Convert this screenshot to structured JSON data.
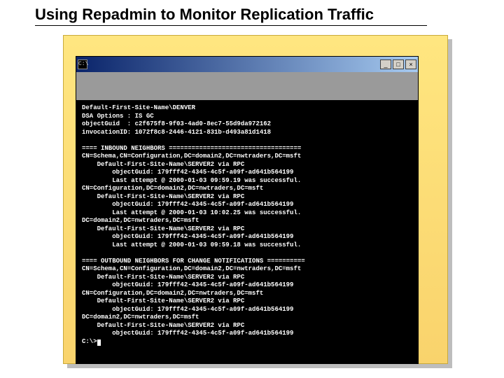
{
  "heading": "Using Repadmin to Monitor Replication Traffic",
  "cmd": {
    "icon_text": "C:\\",
    "btn_min": "_",
    "btn_max": "□",
    "btn_close": "×",
    "prompt": "C:\\>",
    "header": [
      "Default-First-Site-Name\\DENVER",
      "DSA Options : IS GC",
      "objectGuid  : c2f675f8-9f03-4ad0-8ec7-55d9da972162",
      "invocationID: 1072f8c8-2446-4121-831b-d493a81d1418"
    ],
    "inbound_heading": "==== INBOUND NEIGHBORS ===================================",
    "inbound": [
      "CN=Schema,CN=Configuration,DC=domain2,DC=nwtraders,DC=msft",
      "    Default-First-Site-Name\\SERVER2 via RPC",
      "        objectGuid: 179fff42-4345-4c5f-a09f-ad641b564199",
      "        Last attempt @ 2000-01-03 09:59.19 was successful.",
      "CN=Configuration,DC=domain2,DC=nwtraders,DC=msft",
      "    Default-First-Site-Name\\SERVER2 via RPC",
      "        objectGuid: 179fff42-4345-4c5f-a09f-ad641b564199",
      "        Last attempt @ 2000-01-03 10:02.25 was successful.",
      "DC=domain2,DC=nwtraders,DC=msft",
      "    Default-First-Site-Name\\SERVER2 via RPC",
      "        objectGuid: 179fff42-4345-4c5f-a09f-ad641b564199",
      "        Last attempt @ 2000-01-03 09:59.18 was successful."
    ],
    "outbound_heading": "==== OUTBOUND NEIGHBORS FOR CHANGE NOTIFICATIONS ==========",
    "outbound": [
      "CN=Schema,CN=Configuration,DC=domain2,DC=nwtraders,DC=msft",
      "    Default-First-Site-Name\\SERVER2 via RPC",
      "        objectGuid: 179fff42-4345-4c5f-a09f-ad641b564199",
      "CN=Configuration,DC=domain2,DC=nwtraders,DC=msft",
      "    Default-First-Site-Name\\SERVER2 via RPC",
      "        objectGuid: 179fff42-4345-4c5f-a09f-ad641b564199",
      "DC=domain2,DC=nwtraders,DC=msft",
      "    Default-First-Site-Name\\SERVER2 via RPC",
      "        objectGuid: 179fff42-4345-4c5f-a09f-ad641b564199"
    ]
  }
}
